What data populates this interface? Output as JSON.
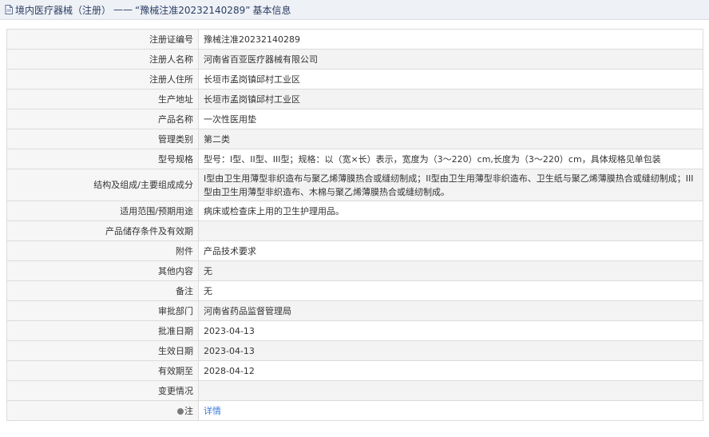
{
  "header": {
    "icon": "document-icon",
    "category": "境内医疗器械（注册）",
    "separator": "——",
    "record_title": "“豫械注准20232140289”",
    "suffix": "基本信息"
  },
  "rows": [
    {
      "label": "注册证编号",
      "value": "豫械注准20232140289"
    },
    {
      "label": "注册人名称",
      "value": "河南省百亚医疗器械有限公司"
    },
    {
      "label": "注册人住所",
      "value": "长垣市孟岗镇邱村工业区"
    },
    {
      "label": "生产地址",
      "value": "长垣市孟岗镇邱村工业区"
    },
    {
      "label": "产品名称",
      "value": "一次性医用垫"
    },
    {
      "label": "管理类别",
      "value": "第二类"
    },
    {
      "label": "型号规格",
      "value": "型号：I型、II型、III型；规格：以（宽×长）表示，宽度为（3～220）cm,长度为（3～220）cm，具体规格见单包装"
    },
    {
      "label": "结构及组成/主要组成成分",
      "value": "I型由卫生用薄型非织造布与聚乙烯薄膜热合或缝纫制成；II型由卫生用薄型非织造布、卫生纸与聚乙烯薄膜热合或缝纫制成；III型由卫生用薄型非织造布、木棉与聚乙烯薄膜热合或缝纫制成。"
    },
    {
      "label": "适用范围/预期用途",
      "value": "病床或检查床上用的卫生护理用品。"
    },
    {
      "label": "产品储存条件及有效期",
      "value": ""
    },
    {
      "label": "附件",
      "value": "产品技术要求"
    },
    {
      "label": "其他内容",
      "value": "无"
    },
    {
      "label": "备注",
      "value": "无"
    },
    {
      "label": "审批部门",
      "value": "河南省药品监督管理局"
    },
    {
      "label": "批准日期",
      "value": "2023-04-13"
    },
    {
      "label": "生效日期",
      "value": "2023-04-13"
    },
    {
      "label": "有效期至",
      "value": "2028-04-12"
    },
    {
      "label": "变更情况",
      "value": ""
    }
  ],
  "note": {
    "icon": "note-dot-icon",
    "label": "注",
    "link_text": "详情"
  },
  "colors": {
    "header_bg": "#eef1f5",
    "label_bg": "#f6f6f6",
    "link": "#3a7bd5"
  }
}
